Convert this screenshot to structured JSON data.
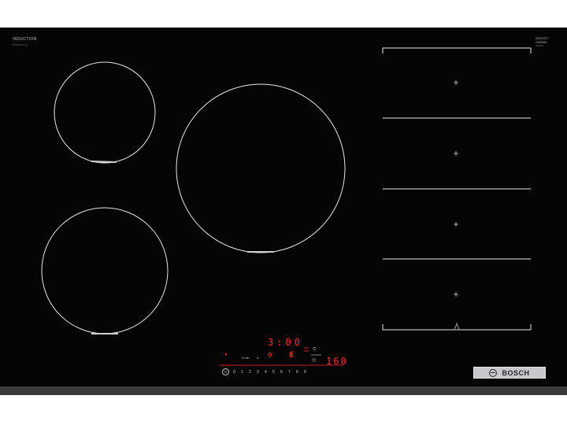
{
  "brand_top_left": {
    "title": "INDUCTION",
    "subtitle": "PVS8xxxxxx"
  },
  "brand_top_right": {
    "line1": "SCHOTT",
    "line2": "CERAN",
    "line3": "xxxxxxx"
  },
  "display": {
    "timer": "3:00",
    "zone_levels": "0 0",
    "zone_e": "E",
    "temperature": "160"
  },
  "controls": {
    "power_symbol": "⏻",
    "power_scale": [
      "0",
      "1",
      "2",
      "3",
      "4",
      "5",
      "6",
      "7",
      "8",
      "9"
    ],
    "timer_icon": "◷",
    "stopwatch_icon": "⏲",
    "small_label_left": "8 min",
    "small_label_mid": "A"
  },
  "logo": {
    "text": "BOSCH"
  },
  "colors": {
    "glass": "#050506",
    "zone_line": "#e6e6e6",
    "display_red": "#ff2a2a",
    "frame": "#3a3a3d"
  }
}
